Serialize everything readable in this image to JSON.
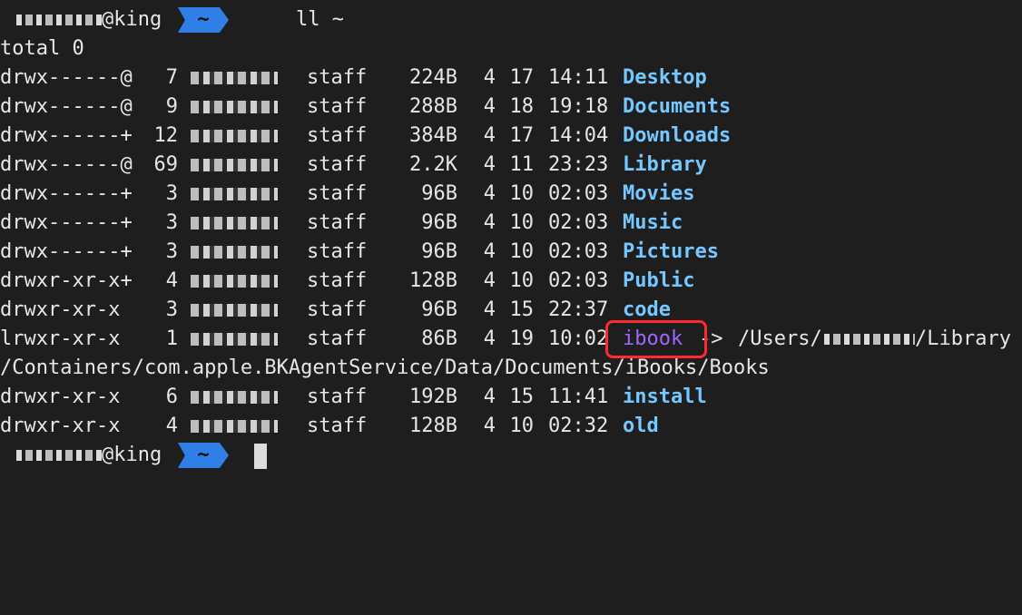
{
  "prompt": {
    "host": "@king",
    "path": "~",
    "command": "ll ~"
  },
  "total": "total 0",
  "owner_group": "staff",
  "entries": [
    {
      "perms": "drwx------@",
      "links": "7",
      "size": "224B",
      "month": "4",
      "day": "17",
      "time": "14:11",
      "name": "Desktop"
    },
    {
      "perms": "drwx------@",
      "links": "9",
      "size": "288B",
      "month": "4",
      "day": "18",
      "time": "19:18",
      "name": "Documents"
    },
    {
      "perms": "drwx------+",
      "links": "12",
      "size": "384B",
      "month": "4",
      "day": "17",
      "time": "14:04",
      "name": "Downloads"
    },
    {
      "perms": "drwx------@",
      "links": "69",
      "size": "2.2K",
      "month": "4",
      "day": "11",
      "time": "23:23",
      "name": "Library"
    },
    {
      "perms": "drwx------+",
      "links": "3",
      "size": "96B",
      "month": "4",
      "day": "10",
      "time": "02:03",
      "name": "Movies"
    },
    {
      "perms": "drwx------+",
      "links": "3",
      "size": "96B",
      "month": "4",
      "day": "10",
      "time": "02:03",
      "name": "Music"
    },
    {
      "perms": "drwx------+",
      "links": "3",
      "size": "96B",
      "month": "4",
      "day": "10",
      "time": "02:03",
      "name": "Pictures"
    },
    {
      "perms": "drwxr-xr-x+",
      "links": "4",
      "size": "128B",
      "month": "4",
      "day": "10",
      "time": "02:03",
      "name": "Public"
    },
    {
      "perms": "drwxr-xr-x",
      "links": "3",
      "size": "96B",
      "month": "4",
      "day": "15",
      "time": "22:37",
      "name": "code"
    },
    {
      "perms": "lrwxr-xr-x",
      "links": "1",
      "size": "86B",
      "month": "4",
      "day": "19",
      "time": "10:02",
      "name": "ibook",
      "link_arrow": "->",
      "target_a": "/Users/",
      "target_b": "/Library",
      "target_c": "/Containers/com.apple.BKAgentService/Data/Documents/iBooks/Books"
    },
    {
      "perms": "drwxr-xr-x",
      "links": "6",
      "size": "192B",
      "month": "4",
      "day": "15",
      "time": "11:41",
      "name": "install"
    },
    {
      "perms": "drwxr-xr-x",
      "links": "4",
      "size": "128B",
      "month": "4",
      "day": "10",
      "time": "02:32",
      "name": "old"
    }
  ],
  "colors": {
    "directory": "#76c7ff",
    "symlink": "#a064ff",
    "highlight": "#ff2a2a",
    "prompt_arrow": "#2f7fe6"
  }
}
